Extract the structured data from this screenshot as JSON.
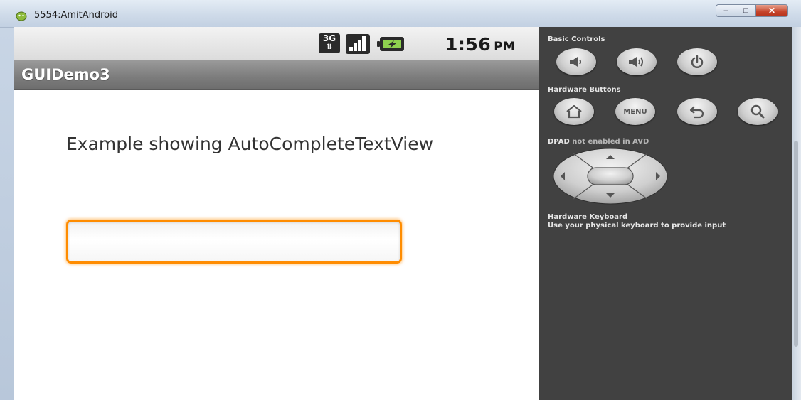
{
  "window": {
    "title": "5554:AmitAndroid",
    "minimize_glyph": "–",
    "maximize_glyph": "□",
    "close_glyph": "✕"
  },
  "status_bar": {
    "network_type": "3G",
    "network_arrows": "⇅",
    "time": "1:56",
    "ampm": "PM",
    "icons": [
      "3g-data-icon",
      "signal-strength-icon",
      "battery-charging-icon"
    ]
  },
  "app": {
    "title": "GUIDemo3",
    "label": "Example showing AutoCompleteTextView",
    "autocomplete": {
      "value": "",
      "focused": true,
      "focus_color": "#ff8c00"
    }
  },
  "controls": {
    "basic_heading": "Basic Controls",
    "basic_buttons": [
      "volume-down-icon",
      "volume-up-icon",
      "power-icon"
    ],
    "hardware_heading": "Hardware Buttons",
    "hardware_buttons": [
      "home-icon",
      "menu",
      "back-icon",
      "search-icon"
    ],
    "menu_label": "MENU",
    "dpad_heading": "DPAD",
    "dpad_status": "not enabled in AVD",
    "keyboard_heading": "Hardware Keyboard",
    "keyboard_text": "Use your physical keyboard to provide input"
  },
  "colors": {
    "panel_bg": "#414141",
    "app_titlebar": "#7c7c7c",
    "focus_orange": "#ff8c00"
  }
}
